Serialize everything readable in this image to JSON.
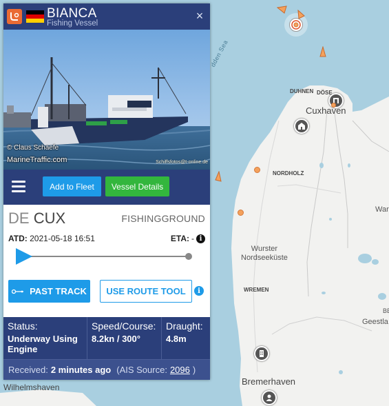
{
  "vessel": {
    "name": "BIANCA",
    "type": "Fishing Vessel",
    "close_label": "×",
    "flag_colors": [
      "#000000",
      "#dd0000",
      "#ffce00"
    ]
  },
  "photo": {
    "credit_line1": "© Claus Schaefe",
    "credit_line2": "MarineTraffic.com",
    "credit_line3": "Schiffsfotos@t-online.de"
  },
  "toolbar": {
    "add_fleet_label": "Add to Fleet",
    "vessel_details_label": "Vessel Details"
  },
  "route": {
    "departure_country": "DE",
    "departure_port": "CUX",
    "destination": "FISHINGGROUND",
    "atd_label": "ATD:",
    "atd_value": "2021-05-18 16:51",
    "eta_label": "ETA:",
    "eta_value": "-",
    "info_symbol": "i",
    "past_track_label": "PAST TRACK",
    "route_tool_label": "USE ROUTE TOOL"
  },
  "stats": {
    "status_label": "Status:",
    "status_value": "Underway Using Engine",
    "speed_label": "Speed/Course:",
    "speed_value": "8.2kn / 300°",
    "draught_label": "Draught:",
    "draught_value": "4.8m"
  },
  "received": {
    "label": "Received:",
    "value": "2 minutes ago",
    "source_prefix": "(AIS Source:",
    "source_link": "2096",
    "source_suffix": ")"
  },
  "map": {
    "labels": {
      "duhnen": "DUHNEN",
      "dose": "DÖSE",
      "cuxhaven": "Cuxhaven",
      "nordholz": "NORDHOLZ",
      "wurster": "Wurster",
      "nordseekuste": "Nordseeküste",
      "wremen": "WREMEN",
      "bremerhaven": "Bremerhaven",
      "wilhelmshaven": "Wilhelmshaven",
      "geestland": "Geestla",
      "war": "War",
      "be": "BE",
      "sea": "dden Sea"
    },
    "colors": {
      "water": "#a9cfe0",
      "land": "#f2f2f0",
      "ship": "#f4a15c"
    }
  }
}
